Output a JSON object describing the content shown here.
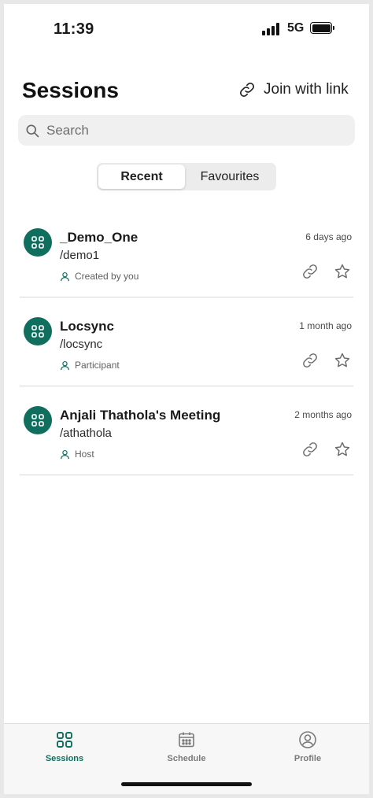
{
  "status_bar": {
    "time": "11:39",
    "network": "5G",
    "icons": [
      "signal-icon",
      "battery-icon"
    ]
  },
  "header": {
    "title": "Sessions",
    "join_label": "Join with link",
    "join_icon": "link-icon"
  },
  "search": {
    "placeholder": "Search",
    "value": "",
    "icon": "search-icon"
  },
  "tabs_filter": {
    "options": [
      {
        "label": "Recent",
        "active": true
      },
      {
        "label": "Favourites",
        "active": false
      }
    ]
  },
  "sessions": [
    {
      "name": "_Demo_One",
      "path": "/demo1",
      "role": "Created by you",
      "time": "6 days ago"
    },
    {
      "name": "Locsync",
      "path": "/locsync",
      "role": "Participant",
      "time": "1 month ago"
    },
    {
      "name": "Anjali Thathola's Meeting",
      "path": "/athathola",
      "role": "Host",
      "time": "2 months ago"
    }
  ],
  "bottom_nav": {
    "items": [
      {
        "label": "Sessions",
        "icon": "grid-icon",
        "active": true
      },
      {
        "label": "Schedule",
        "icon": "calendar-icon",
        "active": false
      },
      {
        "label": "Profile",
        "icon": "profile-icon",
        "active": false
      }
    ]
  },
  "colors": {
    "accent": "#0f6e5e",
    "inactive": "#7a7a7a"
  }
}
